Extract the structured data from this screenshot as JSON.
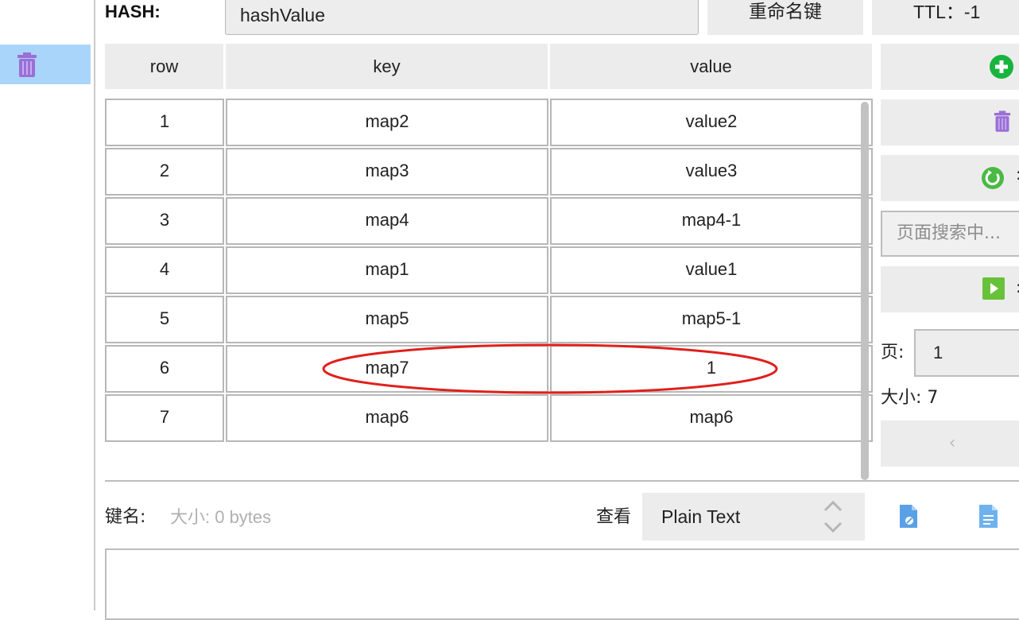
{
  "header": {
    "type_label": "HASH:",
    "key_value": "hashValue",
    "rename_label": "重命名键",
    "ttl_label": "TTL：-1"
  },
  "table": {
    "columns": [
      "row",
      "key",
      "value"
    ],
    "rows": [
      {
        "row": "1",
        "key": "map2",
        "value": "value2"
      },
      {
        "row": "2",
        "key": "map3",
        "value": "value3"
      },
      {
        "row": "3",
        "key": "map4",
        "value": "map4-1"
      },
      {
        "row": "4",
        "key": "map1",
        "value": "value1"
      },
      {
        "row": "5",
        "key": "map5",
        "value": "map5-1"
      },
      {
        "row": "6",
        "key": "map7",
        "value": "1"
      },
      {
        "row": "7",
        "key": "map6",
        "value": "map6"
      }
    ],
    "highlighted_row": 6,
    "highlight_color": "#e0201c"
  },
  "side": {
    "search_placeholder": "页面搜索中...",
    "page_label": "页:",
    "page_value": "1",
    "size_label": "大小: 7",
    "prev_label": "‹"
  },
  "bottom": {
    "keyname_label": "键名:",
    "keysize_label": "大小: 0 bytes",
    "view_label": "查看",
    "view_value": "Plain Text"
  },
  "icons": {
    "sidebar_delete": "trash-icon",
    "add": "plus-circle-icon",
    "delete": "trash-icon",
    "refresh": "refresh-icon",
    "run": "play-icon",
    "copy": "copy-file-icon",
    "format": "document-icon"
  },
  "colors": {
    "sidebar_selection": "#aad5fb",
    "trash": "#9a6fd6",
    "add": "#18b43d",
    "refresh": "#4cb944",
    "play": "#67c23a"
  }
}
